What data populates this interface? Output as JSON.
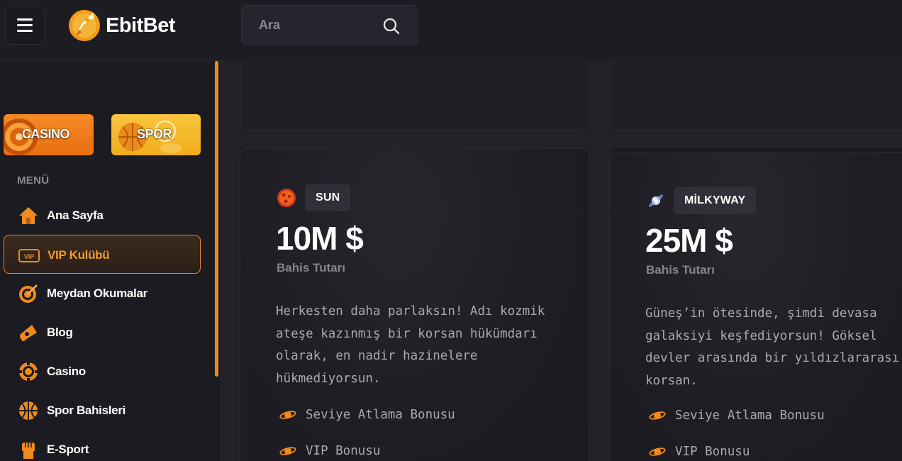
{
  "header": {
    "logo_text": "EbitBet",
    "search_placeholder": "Ara"
  },
  "sidebar": {
    "categories": [
      {
        "label": "CASINO",
        "icon": "roulette-icon"
      },
      {
        "label": "SPOR",
        "icon": "basketball-icon"
      }
    ],
    "menu_title": "MENÜ",
    "items": [
      {
        "label": "Ana Sayfa",
        "icon": "home-icon",
        "active": false
      },
      {
        "label": "VIP Kulübü",
        "icon": "vip-ticket-icon",
        "active": true
      },
      {
        "label": "Meydan Okumalar",
        "icon": "target-icon",
        "active": false
      },
      {
        "label": "Blog",
        "icon": "megaphone-icon",
        "active": false
      },
      {
        "label": "Casino",
        "icon": "chip-icon",
        "active": false
      },
      {
        "label": "Spor Bahisleri",
        "icon": "basketball-icon",
        "active": false
      },
      {
        "label": "E-Sport",
        "icon": "fist-icon",
        "active": false
      }
    ]
  },
  "tiers": [
    {
      "badge": "SUN",
      "icon": "sun-icon",
      "amount": "10M $",
      "amount_label": "Bahis Tutarı",
      "description": "Herkesten daha parlaksın! Adı kozmik ateşe kazınmış bir korsan hükümdarı olarak, en nadir hazinelere hükmediyorsun.",
      "bonuses": [
        "Seviye Atlama Bonusu",
        "VIP Bonusu"
      ]
    },
    {
      "badge": "MİLKYWAY",
      "icon": "galaxy-icon",
      "amount": "25M $",
      "amount_label": "Bahis Tutarı",
      "description": "Güneş’in ötesinde, şimdi devasa galaksiyi keşfediyorsun! Göksel devler arasında bir yıldızlararası korsan.",
      "bonuses": [
        "Seviye Atlama Bonusu",
        "VIP Bonusu"
      ]
    }
  ],
  "colors": {
    "accent": "#f08a1c",
    "background": "#1b1b21",
    "active_label": "#f59a2b"
  }
}
